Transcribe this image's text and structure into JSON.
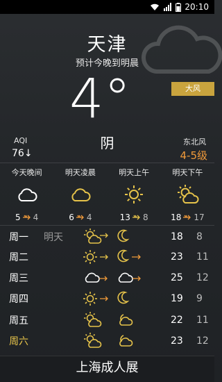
{
  "status": {
    "time": "20:10"
  },
  "city": "天津",
  "forecast_note": "预计今晚到明晨",
  "temperature": "4°",
  "alert_badge": "大风",
  "condition": "阴",
  "aqi": {
    "label": "AQI",
    "value": "76↓"
  },
  "wind": {
    "direction": "东北风",
    "level": "4-5级"
  },
  "periods": [
    {
      "label": "今天晚间",
      "icon": "cloud-icon",
      "high": "5",
      "low": "4"
    },
    {
      "label": "明天凌晨",
      "icon": "cloud-yellow-icon",
      "high": "6",
      "low": "4"
    },
    {
      "label": "明天上午",
      "icon": "sun-icon",
      "high": "13",
      "low": "8"
    },
    {
      "label": "明天下午",
      "icon": "sun-cloud-icon",
      "high": "18",
      "low": "17"
    }
  ],
  "days": [
    {
      "name": "周一",
      "note": "明天",
      "icon1": "sun-cloud-icon",
      "icon2": "moon-icon",
      "high": "18",
      "low": "8"
    },
    {
      "name": "周二",
      "note": "",
      "icon1": "sun-icon",
      "icon2": "moon-icon",
      "high": "23",
      "low": "11"
    },
    {
      "name": "周三",
      "note": "",
      "icon1": "cloud-icon",
      "icon2": "cloud-icon",
      "high": "25",
      "low": "12"
    },
    {
      "name": "周四",
      "note": "",
      "icon1": "sun-icon",
      "icon2": "moon-icon",
      "high": "19",
      "low": "9"
    },
    {
      "name": "周五",
      "note": "",
      "icon1": "sun-cloud-icon",
      "icon2": "moon-cloud-icon",
      "high": "22",
      "low": "11"
    },
    {
      "name": "周六",
      "note": "",
      "icon1": "sun-cloud-icon",
      "icon2": "moon-cloud-icon",
      "high": "23",
      "low": "12"
    }
  ],
  "bottom_banner": "上海成人展",
  "colors": {
    "accent_yellow": "#e6c34a",
    "wind_orange": "#f09a3a",
    "badge": "#c9a43e"
  }
}
